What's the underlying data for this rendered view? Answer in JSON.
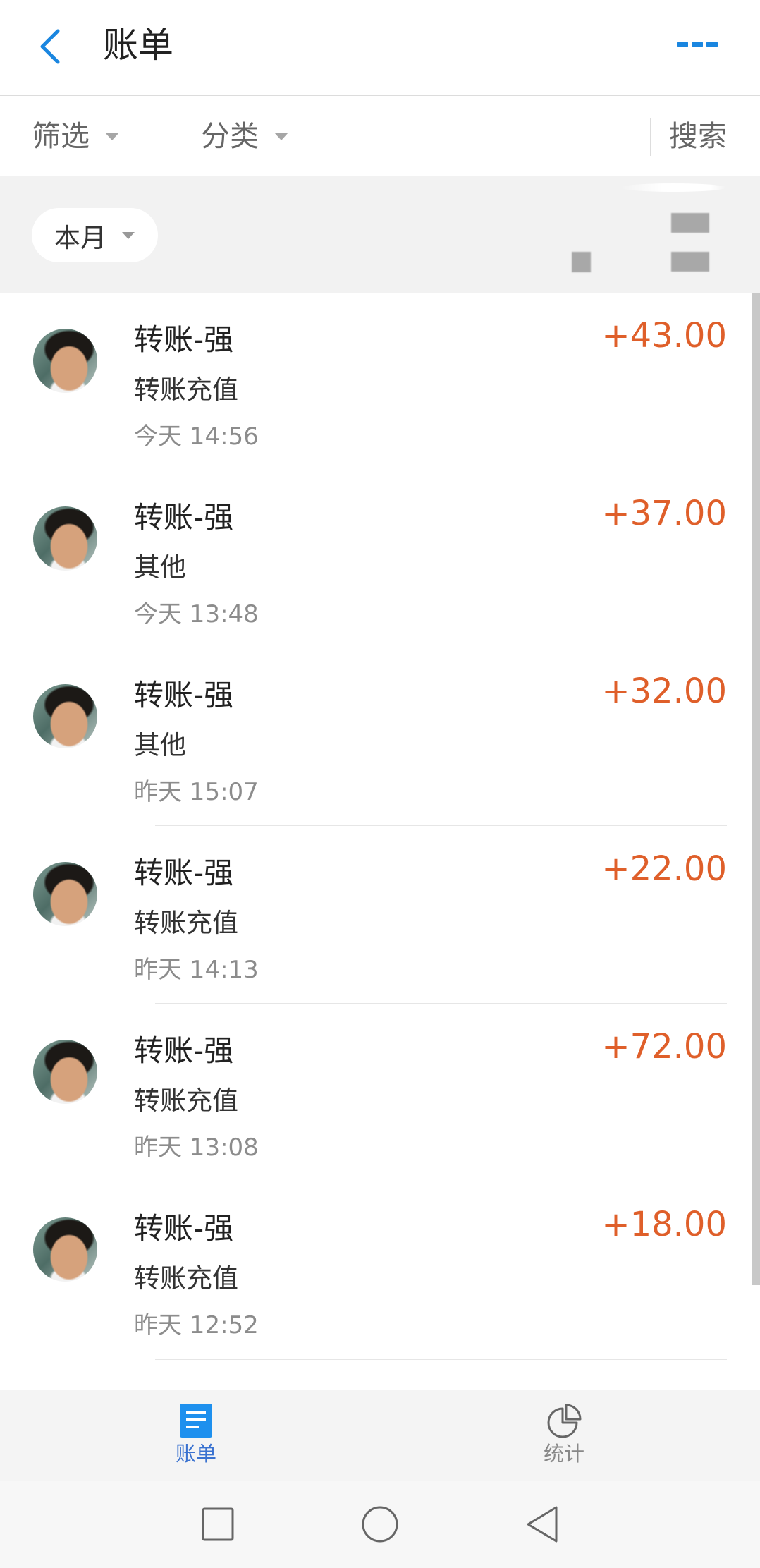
{
  "header": {
    "title": "账单",
    "back_icon": "chevron-left-icon",
    "more_icon": "more-icon"
  },
  "filter_bar": {
    "filter_label": "筛选",
    "category_label": "分类",
    "search_label": "搜索"
  },
  "period": {
    "label": "本月"
  },
  "transactions": [
    {
      "name": "转账-强",
      "note": "转账充值",
      "time": "今天 14:56",
      "amount": "+43.00"
    },
    {
      "name": "转账-强",
      "note": "其他",
      "time": "今天 13:48",
      "amount": "+37.00"
    },
    {
      "name": "转账-强",
      "note": "其他",
      "time": "昨天 15:07",
      "amount": "+32.00"
    },
    {
      "name": "转账-强",
      "note": "转账充值",
      "time": "昨天 14:13",
      "amount": "+22.00"
    },
    {
      "name": "转账-强",
      "note": "转账充值",
      "time": "昨天 13:08",
      "amount": "+72.00"
    },
    {
      "name": "转账-强",
      "note": "转账充值",
      "time": "昨天 12:52",
      "amount": "+18.00"
    }
  ],
  "tabs": [
    {
      "label": "账单",
      "icon": "bill-list-icon",
      "active": true
    },
    {
      "label": "统计",
      "icon": "pie-chart-icon",
      "active": false
    }
  ],
  "system_nav": {
    "icons": [
      "square-icon",
      "circle-icon",
      "triangle-back-icon"
    ]
  },
  "colors": {
    "accent": "#1a86e0",
    "amount_income": "#df5f2a",
    "tab_active": "#3a72d0",
    "tab_inactive": "#888888"
  }
}
